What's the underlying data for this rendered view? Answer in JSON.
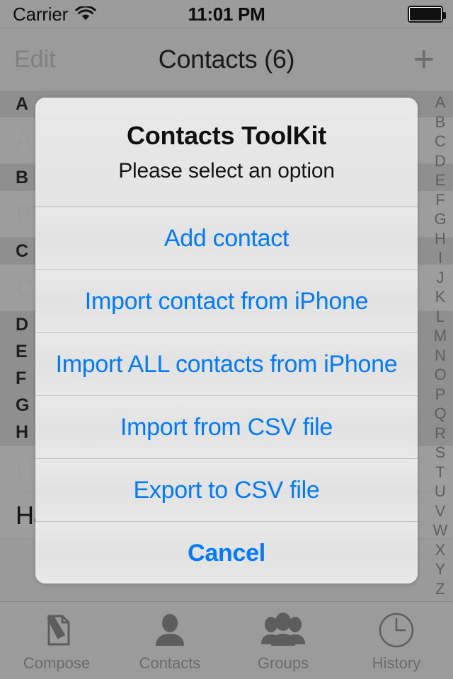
{
  "status_bar": {
    "carrier": "Carrier",
    "wifi_icon": "wifi-icon",
    "time": "11:01 PM",
    "battery_icon": "battery-full-icon"
  },
  "nav_bar": {
    "edit_label": "Edit",
    "title": "Contacts (6)",
    "add_label": "+"
  },
  "contact_list": {
    "sections": [
      {
        "header": "A",
        "rows": [
          "Appleseed, John"
        ]
      },
      {
        "header": "B",
        "rows": [
          "Bell, Kate"
        ]
      },
      {
        "header": "C",
        "rows": [
          "Creative Consulting"
        ]
      },
      {
        "header": "D",
        "rows": []
      },
      {
        "header": "E",
        "rows": []
      },
      {
        "header": "F",
        "rows": []
      },
      {
        "header": "G",
        "rows": []
      },
      {
        "header": "H",
        "rows": [
          "Higgins, Daniel",
          "Haro, Anna"
        ]
      }
    ]
  },
  "index_bar": {
    "letters": [
      "A",
      "B",
      "C",
      "D",
      "E",
      "F",
      "G",
      "H",
      "I",
      "J",
      "K",
      "L",
      "M",
      "N",
      "O",
      "P",
      "Q",
      "R",
      "S",
      "T",
      "U",
      "V",
      "W",
      "X",
      "Y",
      "Z"
    ]
  },
  "alert": {
    "title": "Contacts ToolKit",
    "subtitle": "Please select an option",
    "accent_color": "#007aff",
    "buttons": [
      {
        "label": "Add contact",
        "style": "default"
      },
      {
        "label": "Import contact from iPhone",
        "style": "default"
      },
      {
        "label": "Import ALL contacts from iPhone",
        "style": "default"
      },
      {
        "label": "Import from CSV file",
        "style": "default"
      },
      {
        "label": "Export to CSV file",
        "style": "default"
      },
      {
        "label": "Cancel",
        "style": "cancel"
      }
    ]
  },
  "tab_bar": {
    "tabs": [
      {
        "label": "Compose",
        "icon": "compose-icon"
      },
      {
        "label": "Contacts",
        "icon": "person-icon"
      },
      {
        "label": "Groups",
        "icon": "people-group-icon"
      },
      {
        "label": "History",
        "icon": "clock-icon"
      }
    ]
  }
}
